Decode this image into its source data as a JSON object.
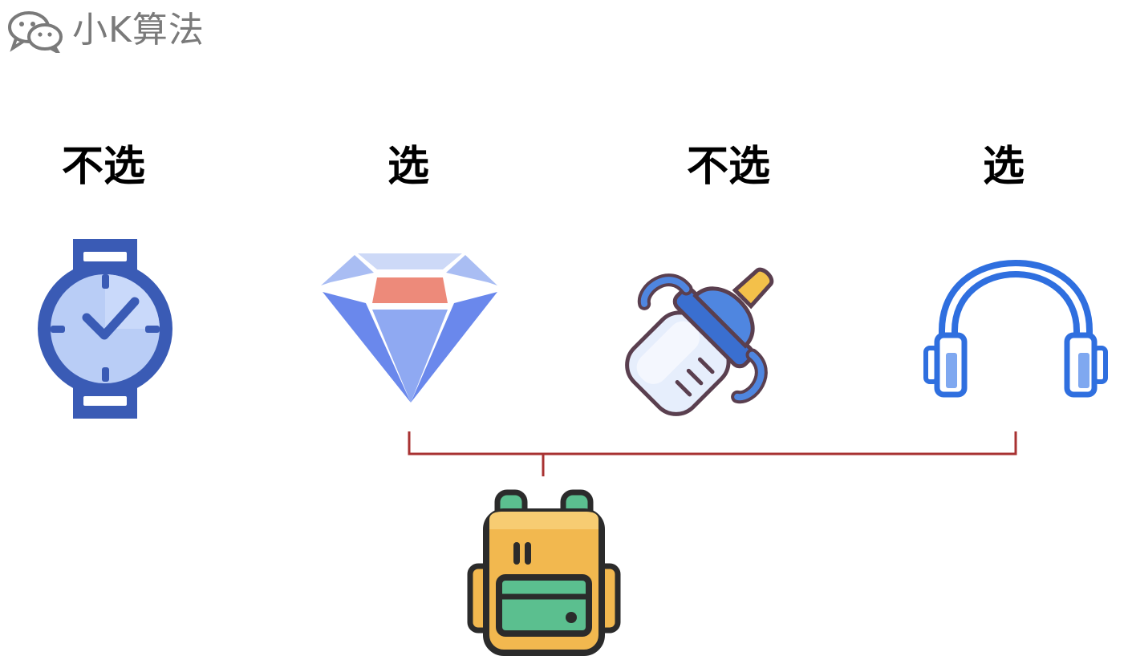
{
  "brand": {
    "name": "小K算法",
    "icon": "wechat-icon"
  },
  "items": [
    {
      "label": "不选",
      "icon": "watch-icon"
    },
    {
      "label": "选",
      "icon": "diamond-icon"
    },
    {
      "label": "不选",
      "icon": "baby-bottle-icon"
    },
    {
      "label": "选",
      "icon": "headphones-icon"
    }
  ],
  "bag": {
    "icon": "backpack-icon"
  },
  "colors": {
    "connector": "#a83232",
    "brand_text": "#7a7a7a",
    "watch": "#3a5bb5",
    "diamond": "#6f8df0",
    "bottle": "#4f86e0",
    "headphones": "#2f6fdf",
    "backpack_body": "#f2b84f",
    "backpack_pocket": "#5bbf8f"
  }
}
